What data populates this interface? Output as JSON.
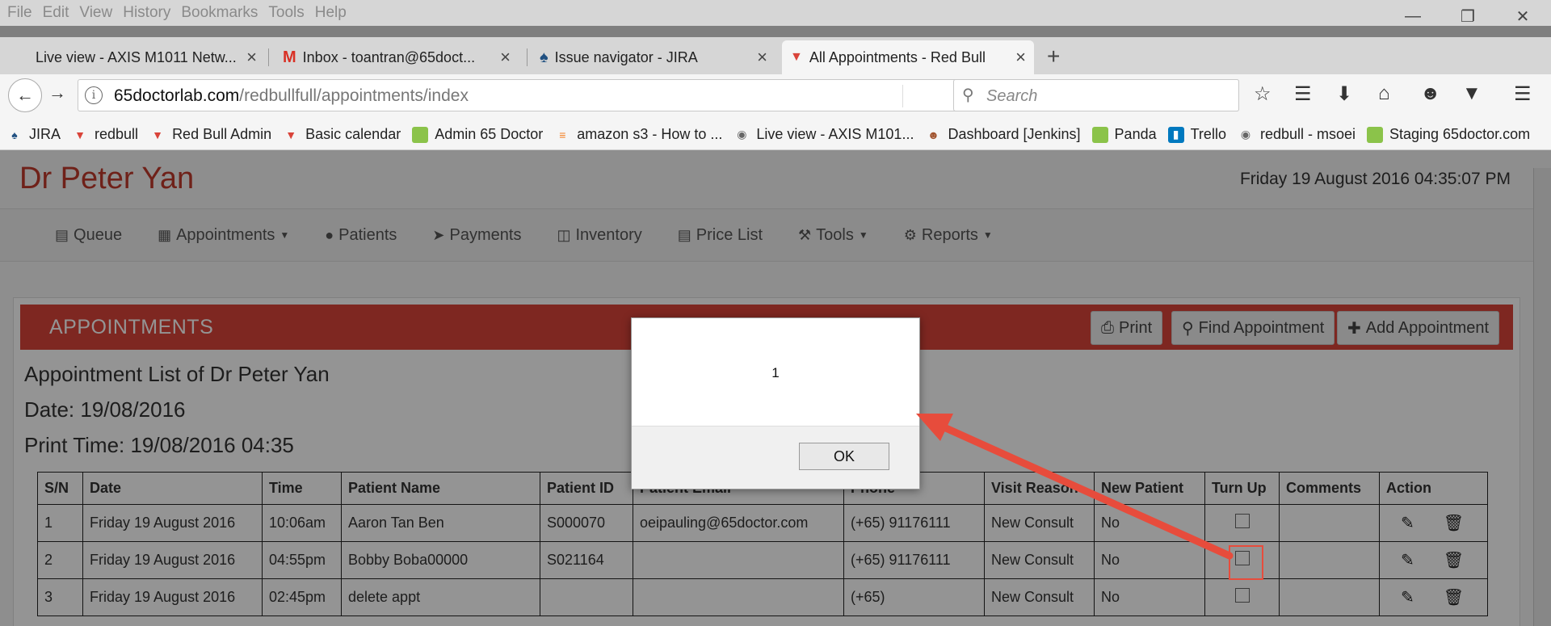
{
  "browser": {
    "menu": [
      "File",
      "Edit",
      "View",
      "History",
      "Bookmarks",
      "Tools",
      "Help"
    ],
    "tabs": [
      {
        "title": "Live view - AXIS M1011 Netw..."
      },
      {
        "title": "Inbox - toantran@65doct..."
      },
      {
        "title": "Issue navigator - JIRA"
      },
      {
        "title": "All Appointments - Red Bull"
      }
    ],
    "url_host": "65doctorlab.com",
    "url_path": "/redbullfull/appointments/index",
    "search_placeholder": "Search",
    "bookmarks": [
      "JIRA",
      "redbull",
      "Red Bull Admin",
      "Basic calendar",
      "Admin 65 Doctor",
      "amazon s3 - How to ...",
      "Live view - AXIS M101...",
      "Dashboard [Jenkins]",
      "Panda",
      "Trello",
      "redbull - msoei",
      "Staging 65doctor.com"
    ]
  },
  "header": {
    "doctor_name": "Dr Peter Yan",
    "datetime": "Friday 19 August 2016 04:35:07 PM"
  },
  "nav": {
    "items": [
      "Queue",
      "Appointments",
      "Patients",
      "Payments",
      "Inventory",
      "Price List",
      "Tools",
      "Reports"
    ]
  },
  "panel": {
    "title": "APPOINTMENTS",
    "print_label": "Print",
    "find_label": "Find Appointment",
    "add_label": "Add Appointment",
    "list_title": "Appointment List of Dr Peter Yan",
    "date_line": "Date: 19/08/2016",
    "print_time_line": "Print Time: 19/08/2016 04:35"
  },
  "table": {
    "columns": [
      "S/N",
      "Date",
      "Time",
      "Patient Name",
      "Patient ID",
      "Patient Email",
      "Phone",
      "Visit Reason",
      "New Patient",
      "Turn Up",
      "Comments",
      "Action"
    ],
    "rows": [
      {
        "sn": "1",
        "date": "Friday 19 August 2016",
        "time": "10:06am",
        "name": "Aaron Tan Ben",
        "pid": "S000070",
        "email": "oeipauling@65doctor.com",
        "phone": "(+65) 91176111",
        "reason": "New Consult",
        "new_patient": "No"
      },
      {
        "sn": "2",
        "date": "Friday 19 August 2016",
        "time": "04:55pm",
        "name": "Bobby Boba00000",
        "pid": "S021164",
        "email": "",
        "phone": "(+65) 91176111",
        "reason": "New Consult",
        "new_patient": "No"
      },
      {
        "sn": "3",
        "date": "Friday 19 August 2016",
        "time": "02:45pm",
        "name": "delete appt",
        "pid": "",
        "email": "",
        "phone": "(+65)",
        "reason": "New Consult",
        "new_patient": "No"
      }
    ]
  },
  "dialog": {
    "message": "1",
    "ok_label": "OK"
  },
  "colors": {
    "brand_red": "#d9443a",
    "annotation_red": "#e74c3c"
  }
}
